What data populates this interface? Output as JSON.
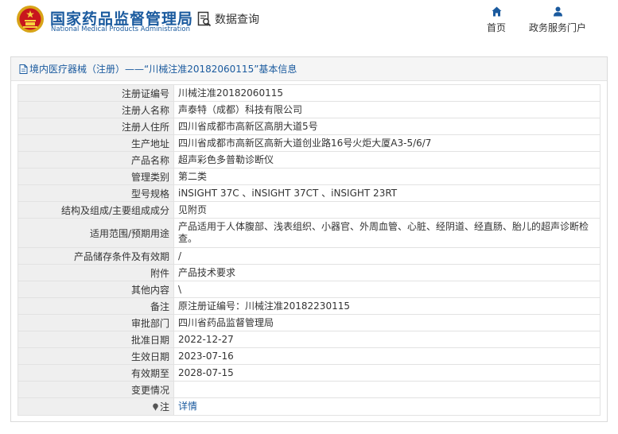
{
  "header": {
    "brand_cn": "国家药品监督管理局",
    "brand_en": "National Medical Products Administration",
    "query_label": "数据查询",
    "nav": [
      {
        "label": "首页",
        "icon": "home-icon"
      },
      {
        "label": "政务服务门户",
        "icon": "user-icon"
      }
    ]
  },
  "panel": {
    "title": "境内医疗器械（注册）——“川械注准20182060115”基本信息"
  },
  "rows": [
    {
      "label": "注册证编号",
      "value": "川械注准20182060115"
    },
    {
      "label": "注册人名称",
      "value": "声泰特（成都）科技有限公司"
    },
    {
      "label": "注册人住所",
      "value": "四川省成都市高新区高朋大道5号"
    },
    {
      "label": "生产地址",
      "value": "四川省成都市高新区高新大道创业路16号火炬大厦A3-5/6/7"
    },
    {
      "label": "产品名称",
      "value": "超声彩色多普勒诊断仪"
    },
    {
      "label": "管理类别",
      "value": "第二类"
    },
    {
      "label": "型号规格",
      "value": "iNSIGHT 37C 、iNSIGHT 37CT 、iNSIGHT 23RT"
    },
    {
      "label": "结构及组成/主要组成成分",
      "value": "见附页"
    },
    {
      "label": "适用范围/预期用途",
      "value": "产品适用于人体腹部、浅表组织、小器官、外周血管、心脏、经阴道、经直肠、胎儿的超声诊断检查。"
    },
    {
      "label": "产品储存条件及有效期",
      "value": "/"
    },
    {
      "label": "附件",
      "value": "产品技术要求"
    },
    {
      "label": "其他内容",
      "value": "\\"
    },
    {
      "label": "备注",
      "value": "原注册证编号：川械注准20182230115"
    },
    {
      "label": "审批部门",
      "value": "四川省药品监督管理局"
    },
    {
      "label": "批准日期",
      "value": "2022-12-27"
    },
    {
      "label": "生效日期",
      "value": "2023-07-16"
    },
    {
      "label": "有效期至",
      "value": "2028-07-15"
    },
    {
      "label": "变更情况",
      "value": ""
    },
    {
      "label": "注",
      "value": "详情"
    }
  ],
  "colors": {
    "brand_blue": "#1a5a9e",
    "label_bg": "#efefef",
    "border": "#e2e2e2"
  }
}
